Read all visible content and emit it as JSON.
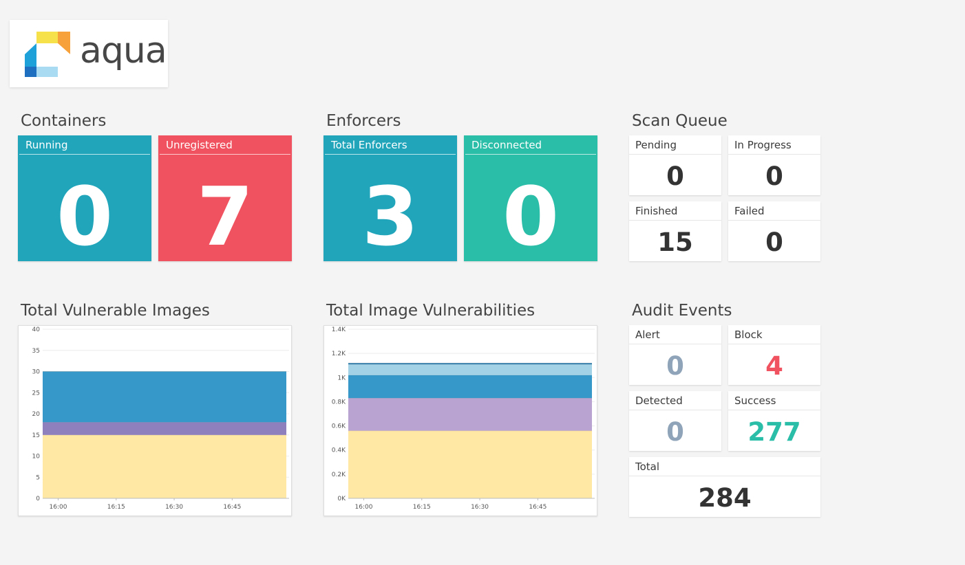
{
  "logo": {
    "text": "aqua"
  },
  "containers": {
    "title": "Containers",
    "tiles": [
      {
        "label": "Running",
        "value": "0",
        "color": "#20a5bb"
      },
      {
        "label": "Unregistered",
        "value": "7",
        "color": "#f0525f"
      }
    ]
  },
  "enforcers": {
    "title": "Enforcers",
    "tiles": [
      {
        "label": "Total Enforcers",
        "value": "3",
        "color": "#20a5bb"
      },
      {
        "label": "Disconnected",
        "value": "0",
        "color": "#2abda7"
      }
    ]
  },
  "scan_queue": {
    "title": "Scan Queue",
    "tiles": [
      {
        "label": "Pending",
        "value": "0",
        "color": "#333333"
      },
      {
        "label": "In Progress",
        "value": "0",
        "color": "#333333"
      },
      {
        "label": "Finished",
        "value": "15",
        "color": "#333333"
      },
      {
        "label": "Failed",
        "value": "0",
        "color": "#333333"
      }
    ]
  },
  "audit_events": {
    "title": "Audit Events",
    "tiles": [
      {
        "label": "Alert",
        "value": "0",
        "color": "#8fa4b8"
      },
      {
        "label": "Block",
        "value": "4",
        "color": "#f0525f"
      },
      {
        "label": "Detected",
        "value": "0",
        "color": "#8fa4b8"
      },
      {
        "label": "Success",
        "value": "277",
        "color": "#2abda7"
      },
      {
        "label": "Total",
        "value": "284",
        "color": "#333333"
      }
    ]
  },
  "vuln_images": {
    "title": "Total Vulnerable Images"
  },
  "image_vulns": {
    "title": "Total Image Vulnerabilities"
  },
  "chart_data": [
    {
      "type": "area",
      "title": "Total Vulnerable Images",
      "x": [
        "15:56",
        "16:59"
      ],
      "x_ticks": [
        "16:00",
        "16:15",
        "16:30",
        "16:45"
      ],
      "y_ticks": [
        "0",
        "5",
        "10",
        "15",
        "20",
        "25",
        "30",
        "35",
        "40"
      ],
      "ylim": [
        0,
        40
      ],
      "stacked": true,
      "series": [
        {
          "values": [
            15,
            15
          ],
          "color": "#ffe8a3"
        },
        {
          "values": [
            3,
            3
          ],
          "color": "#8e7fbd"
        },
        {
          "values": [
            12,
            12
          ],
          "color": "#3598c9"
        }
      ]
    },
    {
      "type": "area",
      "title": "Total Image Vulnerabilities",
      "x": [
        "15:56",
        "16:59"
      ],
      "x_ticks": [
        "16:00",
        "16:15",
        "16:30",
        "16:45"
      ],
      "y_ticks": [
        "0K",
        "0.2K",
        "0.4K",
        "0.6K",
        "0.8K",
        "1K",
        "1.2K",
        "1.4K"
      ],
      "ylim": [
        0,
        1400
      ],
      "stacked": true,
      "series": [
        {
          "values": [
            560,
            560
          ],
          "color": "#ffe8a3"
        },
        {
          "values": [
            270,
            270
          ],
          "color": "#b9a4d1"
        },
        {
          "values": [
            190,
            190
          ],
          "color": "#3598c9"
        },
        {
          "values": [
            90,
            90
          ],
          "color": "#a3d1e6"
        },
        {
          "values": [
            10,
            10
          ],
          "color": "#2f7fb0"
        }
      ]
    }
  ]
}
